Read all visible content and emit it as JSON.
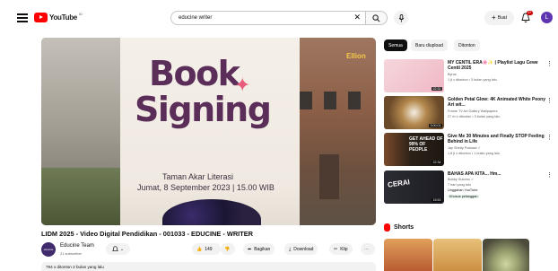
{
  "header": {
    "logo_text": "YouTube",
    "country_code": "ID",
    "search_value": "educine writer",
    "create_label": "Buat",
    "notification_count": "9+",
    "avatar_letter": "L"
  },
  "player": {
    "overlay_line1": "Book",
    "overlay_line2": "Signing",
    "event_place": "Taman Akar Literasi",
    "event_date": "Jumat, 8 September 2023 | 15.00 WIB",
    "corner_text": "Ellion"
  },
  "video": {
    "title": "LIDM 2025 - Video Digital Pendidikan - 001033 - EDUCINE - WRITER",
    "channel_name": "Educine Team",
    "channel_subs": "21 subscriber",
    "channel_avatar_text": "educine",
    "likes": "149",
    "share_label": "Bagikan",
    "download_label": "Download",
    "clip_label": "Klip",
    "description_meta": "794 x ditonton  2 bulan yang lalu"
  },
  "chips": [
    "Semua",
    "Baru diupload",
    "Ditonton"
  ],
  "recommendations": [
    {
      "title": "MY CENTIL ERA🌸✨ | Playlist Lagu Cewe Centil 2025",
      "meta1": "Byroe",
      "meta2": "1 jt x ditonton • 3 bulan yang lalu",
      "duration": "22:31",
      "thumb_colors": [
        "#f5d6dc",
        "#f0b8c5"
      ]
    },
    {
      "title": "Golden Petal Glow: 4K Animated White Peony Art wit...",
      "meta1": "Frame TV Art Gallery Wallpapers",
      "meta2": "27 rb x ditonton • 3 bulan yang lalu",
      "duration": "3:00:01",
      "thumb_colors": [
        "#6b4a2a",
        "#b58a4f"
      ]
    },
    {
      "title": "Give Me 30 Minutes and Finally STOP Feeling Behind in Life",
      "meta1": "Jay Shetty Podcast ✓",
      "meta2": "1,8 jt x ditonton • 1 bulan yang lalu",
      "duration": "22:34",
      "thumb_colors": [
        "#2b2118",
        "#7a4b2a"
      ],
      "thumb_text": "GET AHEAD OF 99% OF PEOPLE"
    },
    {
      "title": "BAHAS APA KITA... Hm...",
      "meta1": "Bobby Sutomo ✓",
      "meta2": "7 hari yang lalu",
      "meta3": "Unggahan YouTube",
      "badge": "Khusus pelanggan",
      "duration": "15:53",
      "thumb_colors": [
        "#1c1c22",
        "#3a3a44"
      ],
      "thumb_text": "CERAI"
    }
  ],
  "shorts": {
    "label": "Shorts",
    "thumb_colors": [
      [
        "#b5542f",
        "#e0a05a"
      ],
      [
        "#c98a3c",
        "#e8c07a"
      ],
      [
        "#4c4a3a",
        "#9aa170"
      ]
    ]
  }
}
